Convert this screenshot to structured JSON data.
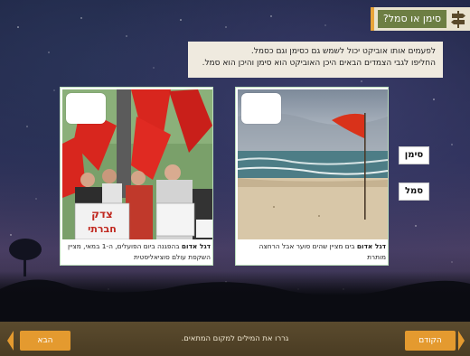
{
  "header": {
    "title": "סימן או סמל?",
    "icon": "signpost-icon"
  },
  "instruction": {
    "line1": "לפעמים אותו אוביקט יכול לשמש גם כסימן וגם כסמל.",
    "line2": "החליפו לגבי הצמדים הבאים היכן האוביקט הוא סימן והיכן הוא סמל."
  },
  "cards": [
    {
      "position": "right",
      "bold": "דגל אדום",
      "text": " בים מציין שהים סוער אבל הרחצה מותרת"
    },
    {
      "position": "left",
      "bold": "דגל אדום",
      "text": " בהפגנה ביום הפועלים, ה-1 במאי, מציין השקפת עולם סוציאליסטית"
    }
  ],
  "protest_signs": {
    "sign1_line1": "צדק",
    "sign1_line2": "חברתי"
  },
  "words": [
    {
      "label": "סימן"
    },
    {
      "label": "סמל"
    }
  ],
  "footer": {
    "message": "גררו את המילים למקום המתאים.",
    "next_label": "הבא",
    "prev_label": "הקודם"
  },
  "colors": {
    "accent": "#e49a2f",
    "title_bg": "#6d7e43",
    "bar": "#4a3c23"
  }
}
